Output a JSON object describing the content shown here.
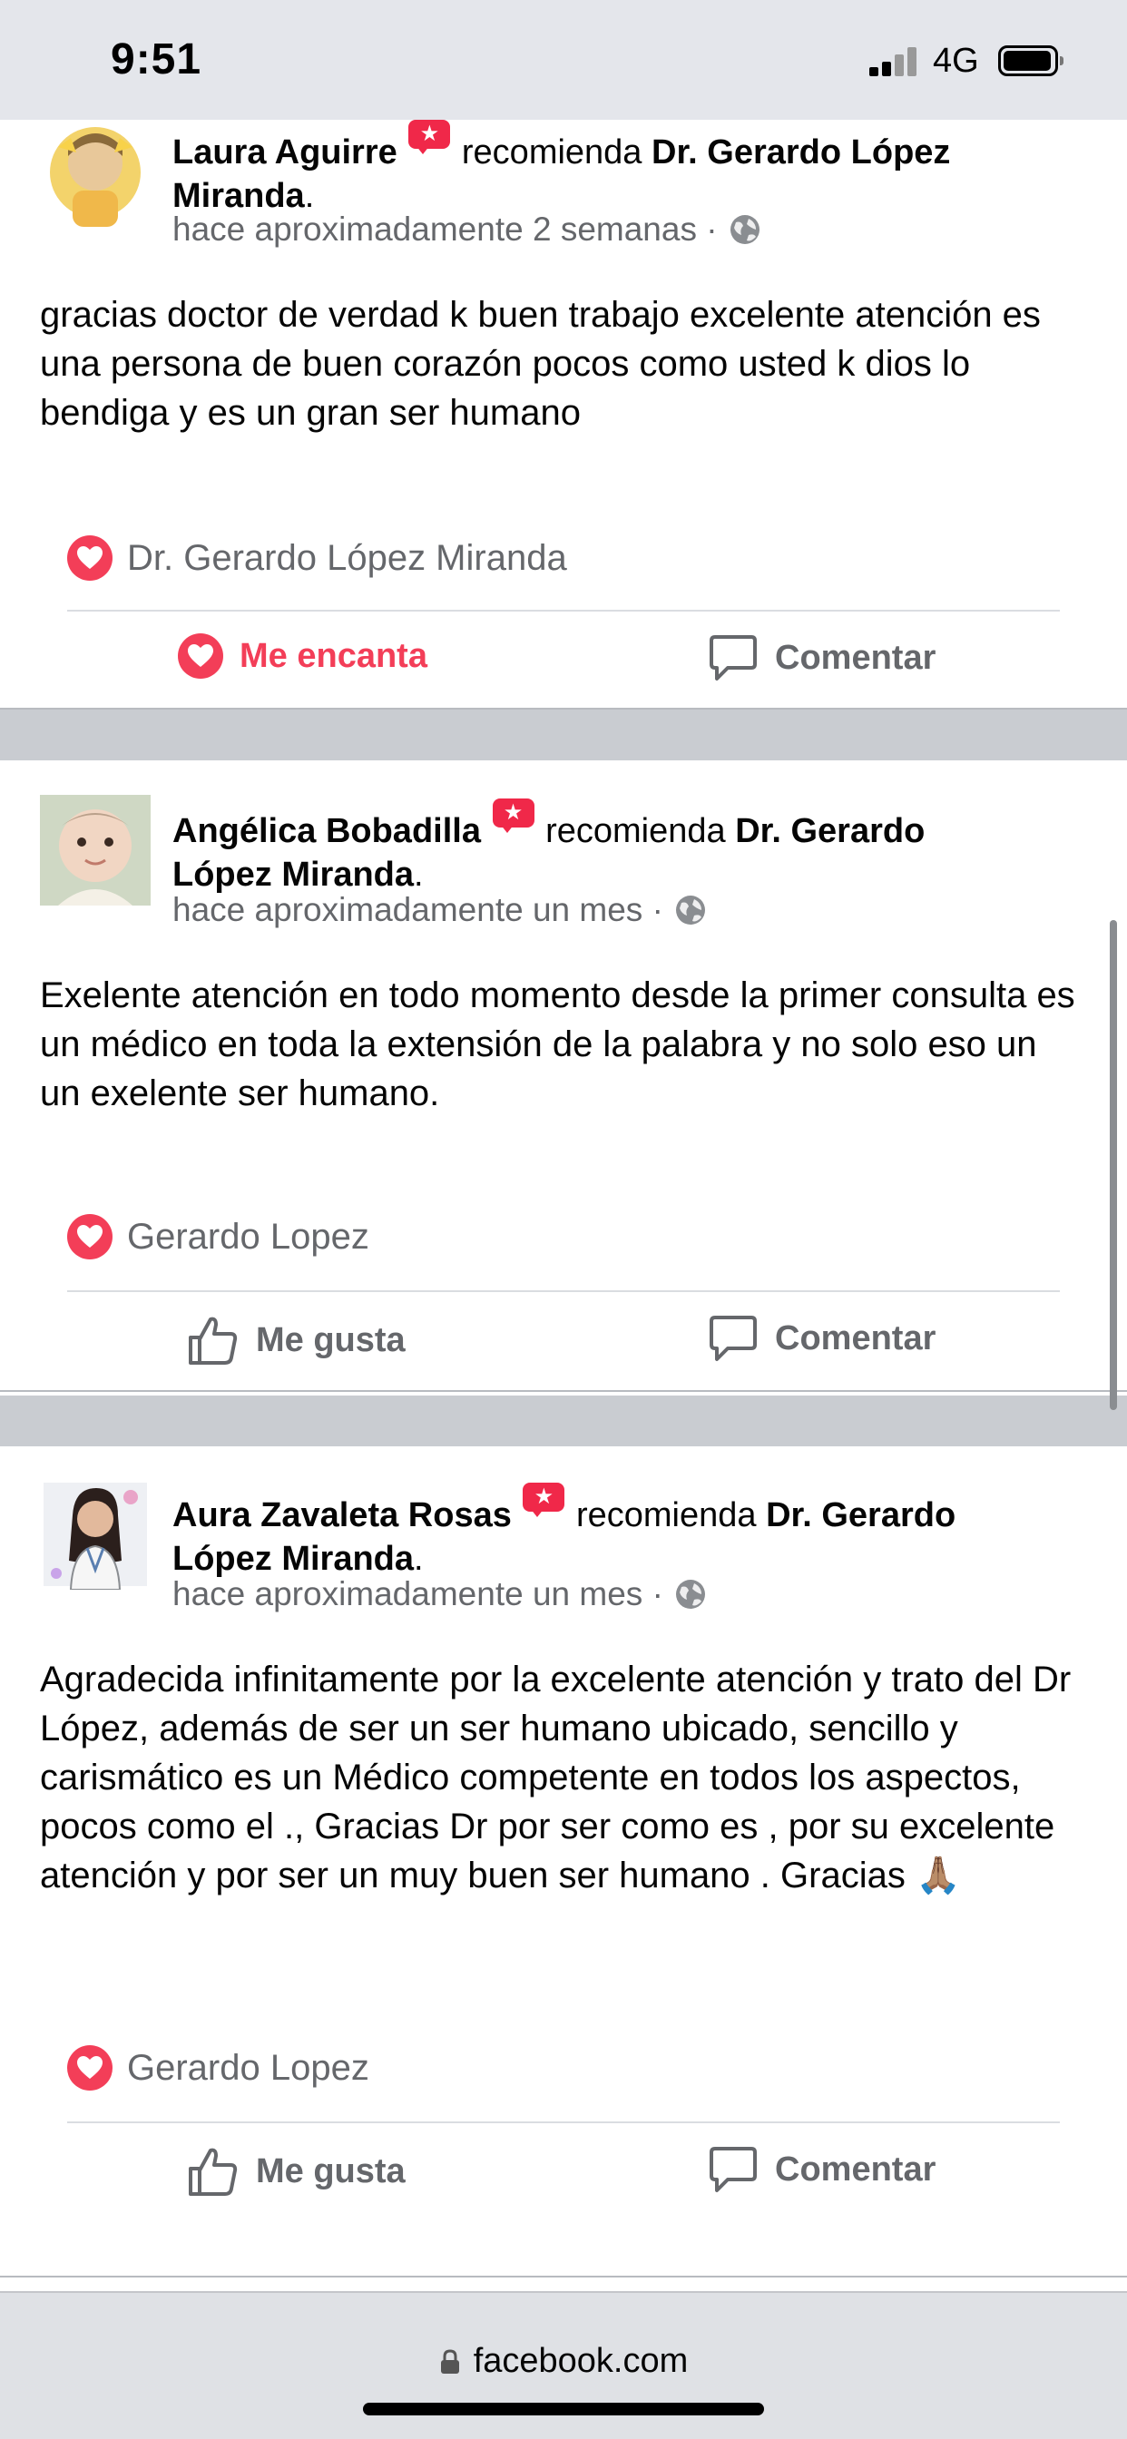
{
  "status_bar": {
    "time": "9:51",
    "network": "4G"
  },
  "posts": [
    {
      "author": "Laura Aguirre",
      "verb": "recomienda",
      "page_name_line1": "Dr. Gerardo López",
      "page_name_line2": "Miranda",
      "period": ".",
      "timestamp": "hace aproximadamente 2 semanas ·",
      "text": "gracias doctor de verdad k buen trabajo excelente atención es una persona de buen corazón pocos como usted k dios lo bendiga y es un gran ser humano",
      "reactor": "Dr. Gerardo López Miranda",
      "like_label": "Me encanta",
      "comment_label": "Comentar"
    },
    {
      "author": "Angélica Bobadilla",
      "verb": "recomienda",
      "page_name_line1": "Dr. Gerardo",
      "page_name_line2": "López Miranda",
      "period": ".",
      "timestamp": "hace aproximadamente un mes ·",
      "text": "Exelente atención en todo momento desde la primer consulta es un médico en toda la extensión de la palabra y no solo eso un un exelente ser humano.",
      "reactor": "Gerardo Lopez",
      "like_label": "Me gusta",
      "comment_label": "Comentar"
    },
    {
      "author": "Aura Zavaleta Rosas",
      "verb": "recomienda",
      "page_name_line1": "Dr. Gerardo",
      "page_name_line2": "López Miranda",
      "period": ".",
      "timestamp": "hace aproximadamente un mes ·",
      "text": "Agradecida infinitamente por la excelente atención y trato del Dr López, además de ser un ser humano ubicado, sencillo y carismático es un Médico competente en todos los aspectos, pocos como el ., Gracias Dr por ser como es , por su excelente atención y por ser un muy buen ser humano . Gracias 🙏🏽",
      "reactor": "Gerardo Lopez",
      "like_label": "Me gusta",
      "comment_label": "Comentar"
    }
  ],
  "browser": {
    "url": "facebook.com"
  },
  "colors": {
    "love": "#f33e58",
    "badge": "#f02849",
    "secondary_text": "#65676b"
  }
}
